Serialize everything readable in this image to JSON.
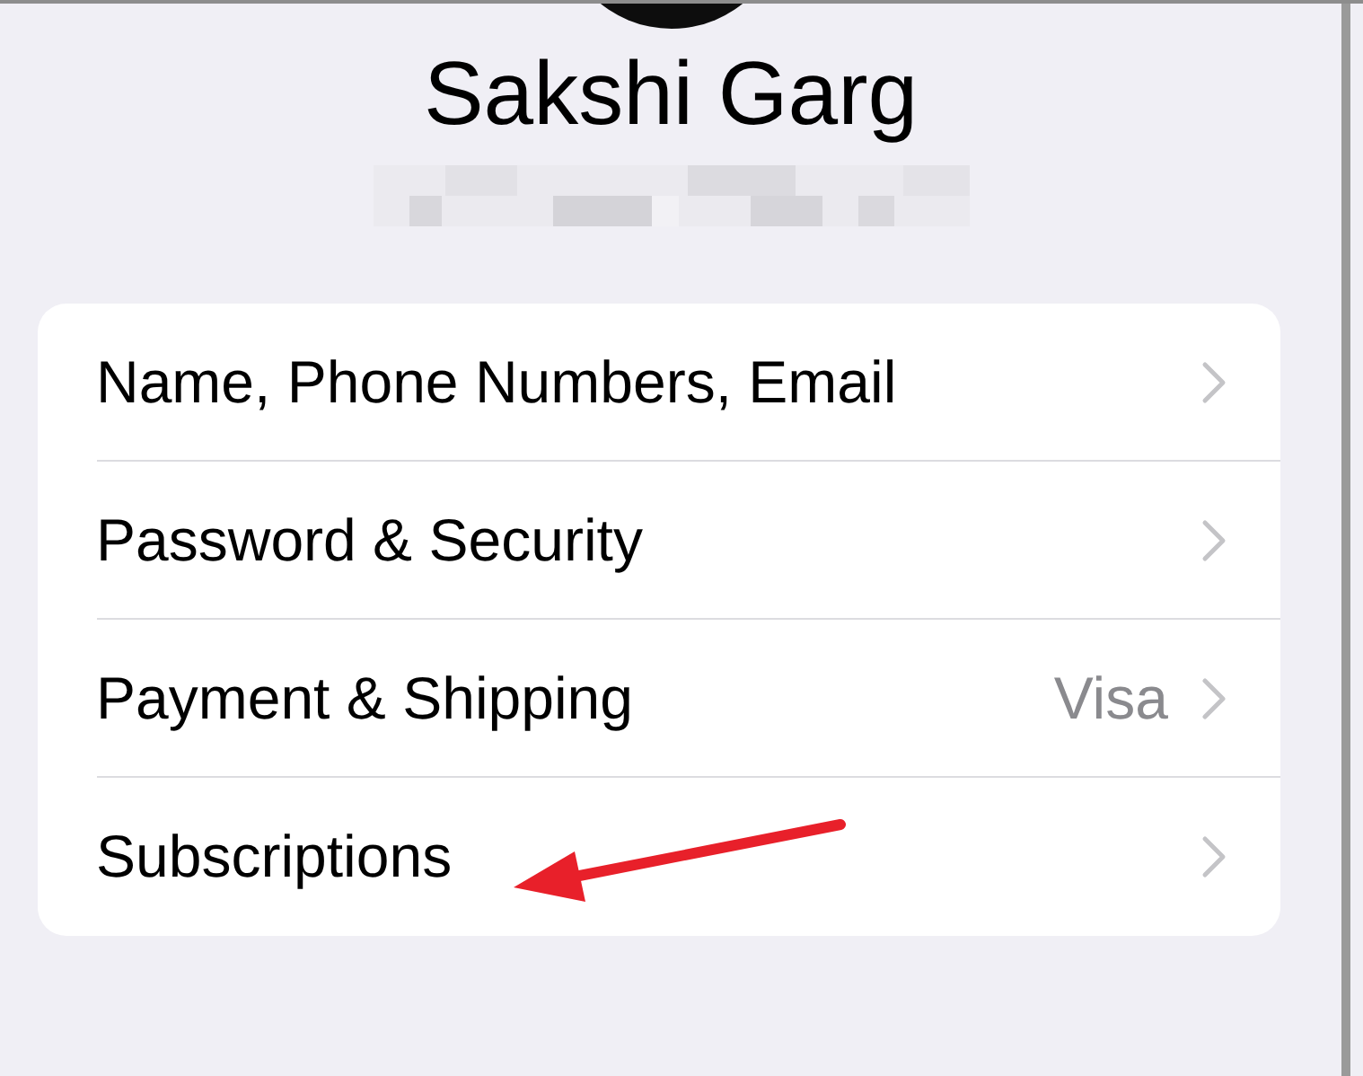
{
  "profile": {
    "name": "Sakshi Garg"
  },
  "menu": [
    {
      "label": "Name, Phone Numbers, Email"
    },
    {
      "label": "Password & Security"
    },
    {
      "label": "Payment & Shipping",
      "value": "Visa"
    },
    {
      "label": "Subscriptions"
    }
  ]
}
